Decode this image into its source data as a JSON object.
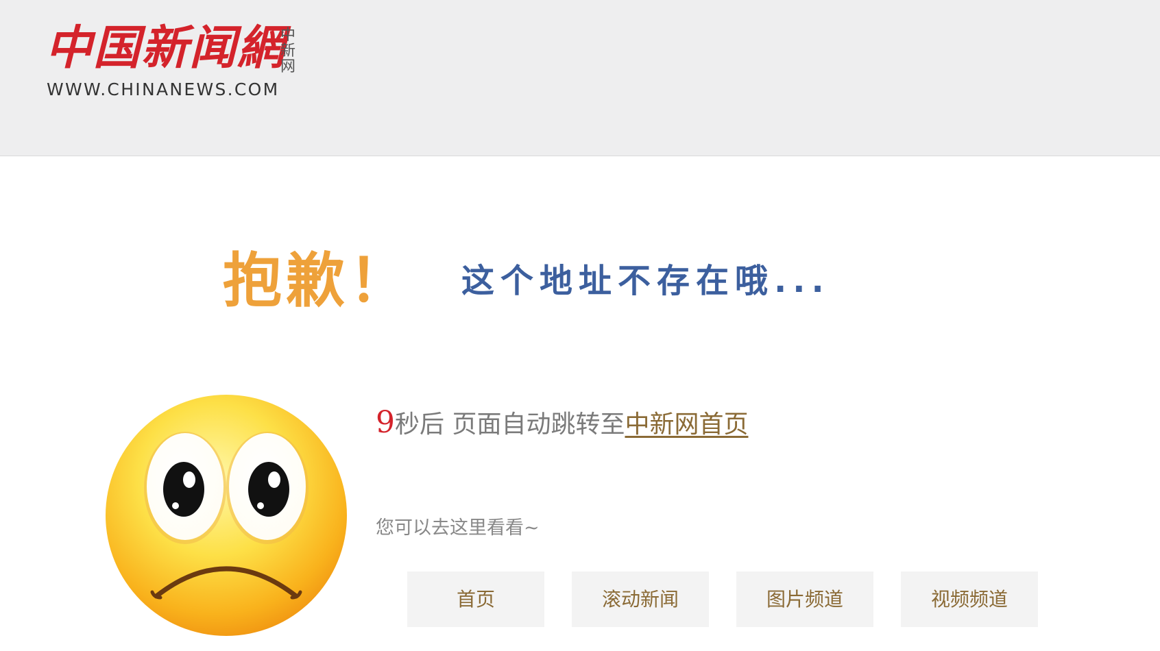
{
  "header": {
    "logo_cn": "中国新闻網",
    "logo_side": "中新网",
    "logo_url": "WWW.CHINANEWS.COM"
  },
  "error": {
    "sorry": "抱歉！",
    "message": "这个地址不存在哦..."
  },
  "redirect": {
    "seconds": "9",
    "text": "秒后 页面自动跳转至",
    "link": "中新网首页"
  },
  "suggest": {
    "text": "您可以去这里看看~"
  },
  "quick_links": [
    {
      "label": "首页"
    },
    {
      "label": "滚动新闻"
    },
    {
      "label": "图片频道"
    },
    {
      "label": "视频频道"
    }
  ],
  "icons": {
    "emoji": "sad-face-icon"
  }
}
